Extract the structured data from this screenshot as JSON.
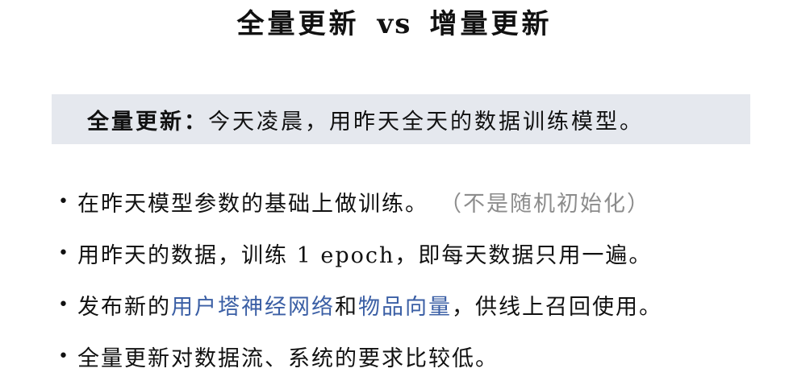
{
  "title": {
    "left": "全量更新",
    "vs": "vs",
    "right": "增量更新"
  },
  "banner": {
    "term": "全量更新",
    "separator": "：",
    "text": "今天凌晨，用昨天全天的数据训练模型。"
  },
  "bullets": [
    {
      "text": "在昨天模型参数的基础上做训练。",
      "note": "（不是随机初始化）"
    },
    {
      "text": "用昨天的数据，训练 1 epoch，即每天数据只用一遍。"
    },
    {
      "prefix": "发布新的",
      "highlight1": "用户塔神经网络",
      "middle": "和",
      "highlight2": "物品向量",
      "suffix": "，供线上召回使用。"
    },
    {
      "text": "全量更新对数据流、系统的要求比较低。"
    }
  ],
  "bullet_glyph": "•",
  "colors": {
    "banner_bg": "#e5e8ee",
    "highlight": "#3b5fa5",
    "muted": "#8c8c8c"
  }
}
